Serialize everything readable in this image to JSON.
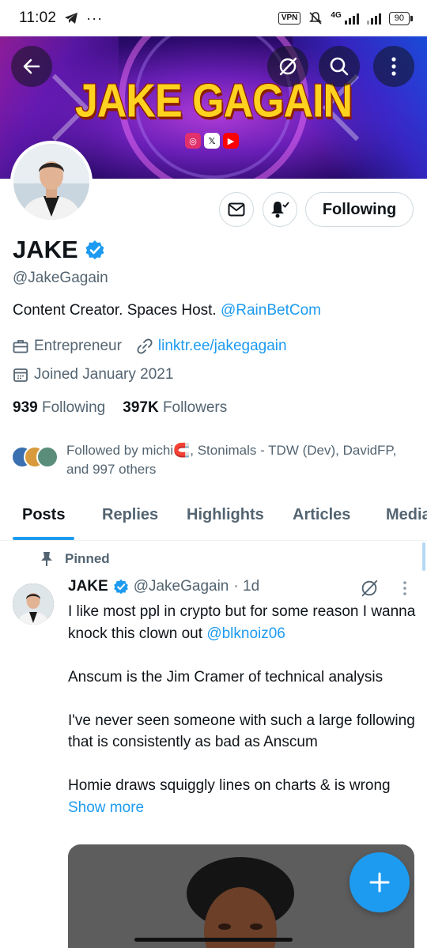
{
  "status_bar": {
    "time": "11:02",
    "vpn": "VPN",
    "network": "4G",
    "battery": "90"
  },
  "banner": {
    "title": "JAKE GAGAIN",
    "gradient_colors": [
      "#0f0a3a",
      "#6b1fb8",
      "#b03bd6",
      "#1c5cff"
    ],
    "title_color": "#ffd21f",
    "social_icons": [
      "instagram-icon",
      "x-icon",
      "youtube-icon"
    ]
  },
  "header_actions": {
    "back": "back-arrow-icon",
    "grok": "grok-icon",
    "search": "search-icon",
    "more": "more-vertical-icon"
  },
  "profile": {
    "display_name": "JAKE",
    "handle": "@JakeGagain",
    "bio_text": "Content Creator. Spaces Host. ",
    "bio_link": "@RainBetCom",
    "category": "Entrepreneur",
    "website": "linktr.ee/jakegagain",
    "joined": "Joined January 2021",
    "following_count": "939",
    "following_label": "Following",
    "followers_count": "397K",
    "followers_label": "Followers",
    "followed_by_text": "Followed by michi🧲, Stonimals - TDW (Dev), DavidFP, and 997 others",
    "following_button": "Following",
    "accent_color": "#1d9bf0"
  },
  "tabs": [
    {
      "label": "Posts",
      "active": true
    },
    {
      "label": "Replies",
      "active": false
    },
    {
      "label": "Highlights",
      "active": false
    },
    {
      "label": "Articles",
      "active": false
    },
    {
      "label": "Media",
      "active": false
    }
  ],
  "post": {
    "pinned_label": "Pinned",
    "author": "JAKE",
    "handle": "@JakeGagain",
    "time": "· 1d",
    "paragraphs": [
      "I like most ppl in crypto but for some reason I wanna knock this clown out ",
      "Anscum is the Jim Cramer of technical analysis",
      "I've never seen someone with such a large following that is consistently as bad as Anscum",
      "Homie draws squiggly lines on charts & is wrong "
    ],
    "mention": "@blknoiz06",
    "show_more": "Show more"
  },
  "fab": {
    "icon": "plus-icon"
  }
}
